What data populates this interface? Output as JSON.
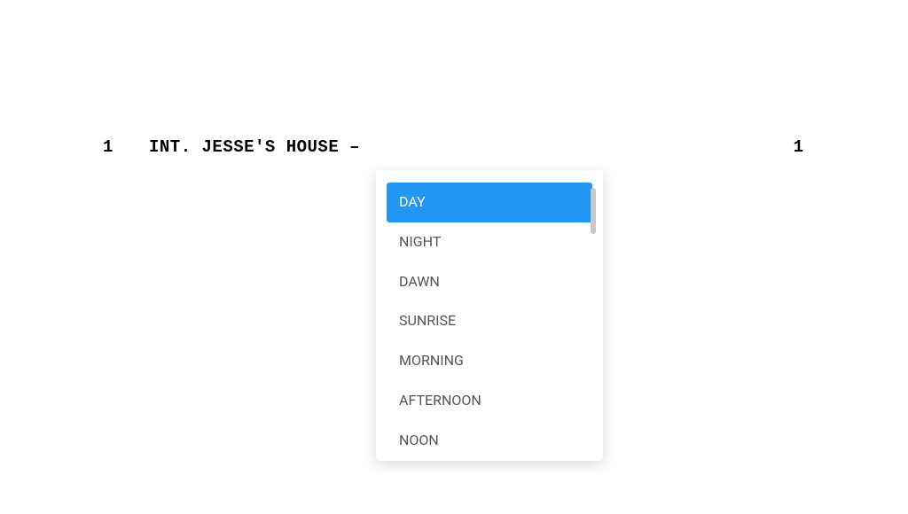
{
  "scene": {
    "number_left": "1",
    "number_right": "1",
    "heading": "INT. JESSE'S HOUSE –"
  },
  "dropdown": {
    "items": [
      {
        "label": "DAY",
        "selected": true
      },
      {
        "label": "NIGHT",
        "selected": false
      },
      {
        "label": "DAWN",
        "selected": false
      },
      {
        "label": "SUNRISE",
        "selected": false
      },
      {
        "label": "MORNING",
        "selected": false
      },
      {
        "label": "AFTERNOON",
        "selected": false
      },
      {
        "label": "NOON",
        "selected": false
      }
    ]
  }
}
